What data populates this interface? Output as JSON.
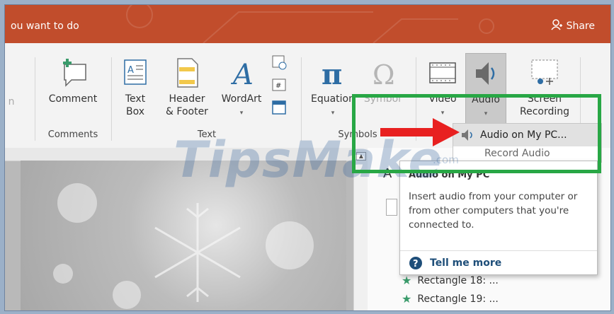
{
  "titlebar": {
    "tell_me": "ou want to do",
    "share": "Share"
  },
  "ribbon": {
    "partial_left": "n",
    "comment": "Comment",
    "comments_group": "Comments",
    "text_box": [
      "Text",
      "Box"
    ],
    "header_footer": [
      "Header",
      "& Footer"
    ],
    "wordart": "WordArt",
    "text_group": "Text",
    "equation": "Equation",
    "symbol": "Symbol",
    "symbols_group": "Symbols",
    "video": "Video",
    "audio": "Audio",
    "screen_recording": [
      "Screen",
      "Recording"
    ]
  },
  "audio_menu": {
    "item1": "Audio on My PC...",
    "item2_partial": "Record Audio"
  },
  "tooltip": {
    "title": "Audio on My PC",
    "body": "Insert audio from your computer or from other computers that you're connected to.",
    "more": "Tell me more"
  },
  "selection_pane": {
    "items": [
      "Rectangle 18: ...",
      "Rectangle 19: ..."
    ],
    "partial_letter": "A"
  },
  "watermark": {
    "text": "TipsMake",
    "sub": ".com"
  },
  "colors": {
    "title_bar": "#c14d2c",
    "highlight_box": "#28a745",
    "arrow": "#e82020"
  }
}
